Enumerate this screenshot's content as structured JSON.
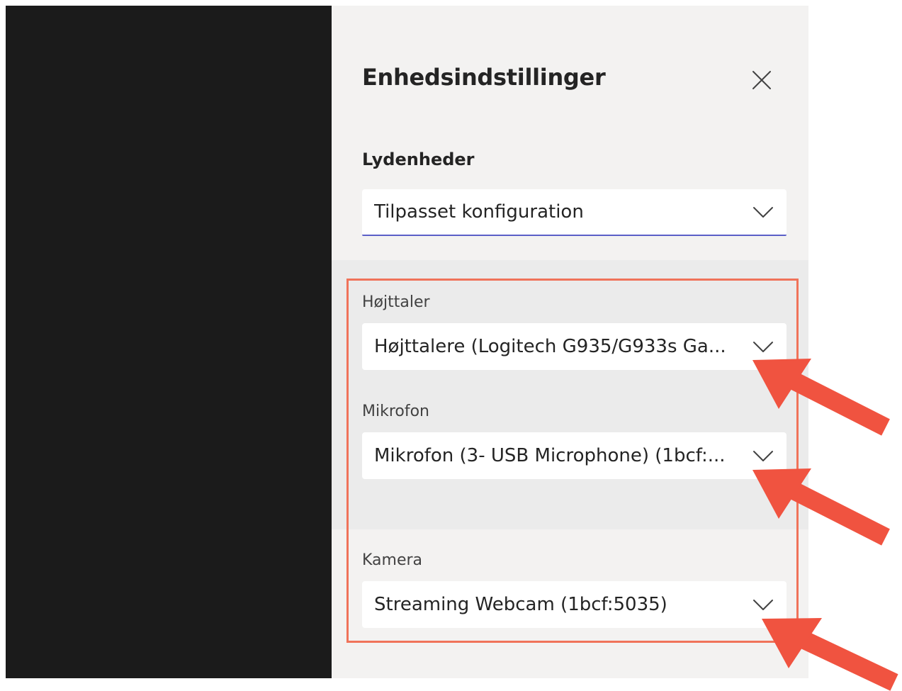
{
  "panel": {
    "title": "Enhedsindstillinger"
  },
  "audio": {
    "section_label": "Lydenheder",
    "config_value": "Tilpasset konfiguration"
  },
  "speaker": {
    "label": "Højttaler",
    "value": "Højttalere (Logitech G935/G933s Ga..."
  },
  "microphone": {
    "label": "Mikrofon",
    "value": "Mikrofon (3- USB Microphone) (1bcf:..."
  },
  "camera": {
    "label": "Kamera",
    "value": "Streaming Webcam (1bcf:5035)"
  },
  "icons": {
    "close": "close-icon",
    "dropdown": "chevron-down-icon",
    "annotation": "red-arrow-icon"
  },
  "colors": {
    "accent": "#5b5fc7",
    "highlight": "#f0735a",
    "arrow": "#f05340"
  }
}
